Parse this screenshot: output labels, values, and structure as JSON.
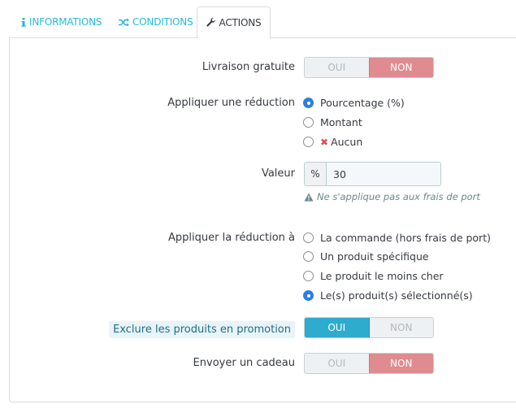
{
  "tabs": [
    {
      "label": "INFORMATIONS",
      "icon": "info-icon"
    },
    {
      "label": "CONDITIONS",
      "icon": "shuffle-icon"
    },
    {
      "label": "ACTIONS",
      "icon": "wrench-icon"
    }
  ],
  "free_shipping": {
    "label": "Livraison gratuite",
    "yes": "OUI",
    "no": "NON",
    "selected": "NON"
  },
  "discount": {
    "label": "Appliquer une réduction",
    "options": [
      "Pourcentage (%)",
      "Montant",
      "Aucun"
    ],
    "selected": "Pourcentage (%)"
  },
  "value": {
    "label": "Valeur",
    "addon": "%",
    "value": "30",
    "help": "Ne s'applique pas aux frais de port"
  },
  "apply_to": {
    "label": "Appliquer la réduction à",
    "options": [
      "La commande (hors frais de port)",
      "Un produit spécifique",
      "Le produit le moins cher",
      "Le(s) produit(s) sélectionné(s)"
    ],
    "selected": "Le(s) produit(s) sélectionné(s)"
  },
  "exclude_promo": {
    "label": "Exclure les produits en promotion",
    "yes": "OUI",
    "no": "NON",
    "selected": "OUI"
  },
  "gift": {
    "label": "Envoyer un cadeau",
    "yes": "OUI",
    "no": "NON",
    "selected": "NON"
  },
  "colors": {
    "accent": "#25b9d7",
    "active_yes": "#2eacce",
    "active_no": "#e08b8f",
    "radio_checked": "#2b7fe0"
  }
}
